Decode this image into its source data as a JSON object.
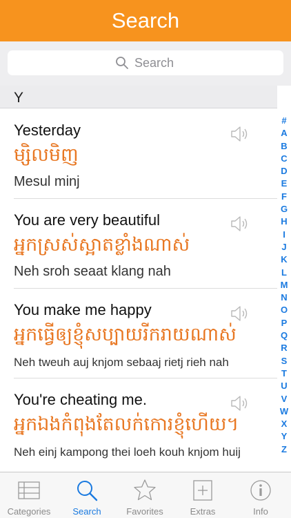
{
  "header": {
    "title": "Search"
  },
  "search": {
    "placeholder": "Search"
  },
  "section": {
    "letter": "Y"
  },
  "entries": [
    {
      "english": "Yesterday",
      "khmer": "ម្សិលមិញ",
      "romanization": "Mesul minj"
    },
    {
      "english": "You are very beautiful",
      "khmer": "អ្នកស្រស់ស្អាតខ្លាំងណាស់",
      "romanization": "Neh sroh seaat klang nah"
    },
    {
      "english": "You make me happy",
      "khmer": "អ្នកធ្វើឲ្យខ្ញុំសប្បាយរីករាយណាស់",
      "romanization": "Neh tweuh auj knjom sebaaj rietj rieh nah"
    },
    {
      "english": "You're cheating me.",
      "khmer": "អ្នកឯងកំពុងតែលក់កោរខ្ញុំហើយ។",
      "romanization": "Neh einj kampong thei loeh kouh knjom huij"
    }
  ],
  "index": [
    "#",
    "A",
    "B",
    "C",
    "D",
    "E",
    "F",
    "G",
    "H",
    "I",
    "J",
    "K",
    "L",
    "M",
    "N",
    "O",
    "P",
    "Q",
    "R",
    "S",
    "T",
    "U",
    "V",
    "W",
    "X",
    "Y",
    "Z"
  ],
  "tabs": [
    {
      "label": "Categories",
      "icon": "list-icon"
    },
    {
      "label": "Search",
      "icon": "search-icon"
    },
    {
      "label": "Favorites",
      "icon": "star-icon"
    },
    {
      "label": "Extras",
      "icon": "plus-box-icon"
    },
    {
      "label": "Info",
      "icon": "info-icon"
    }
  ],
  "colors": {
    "accent": "#f7931e",
    "khmer_text": "#e87722",
    "active_tab": "#1a7ae0"
  }
}
